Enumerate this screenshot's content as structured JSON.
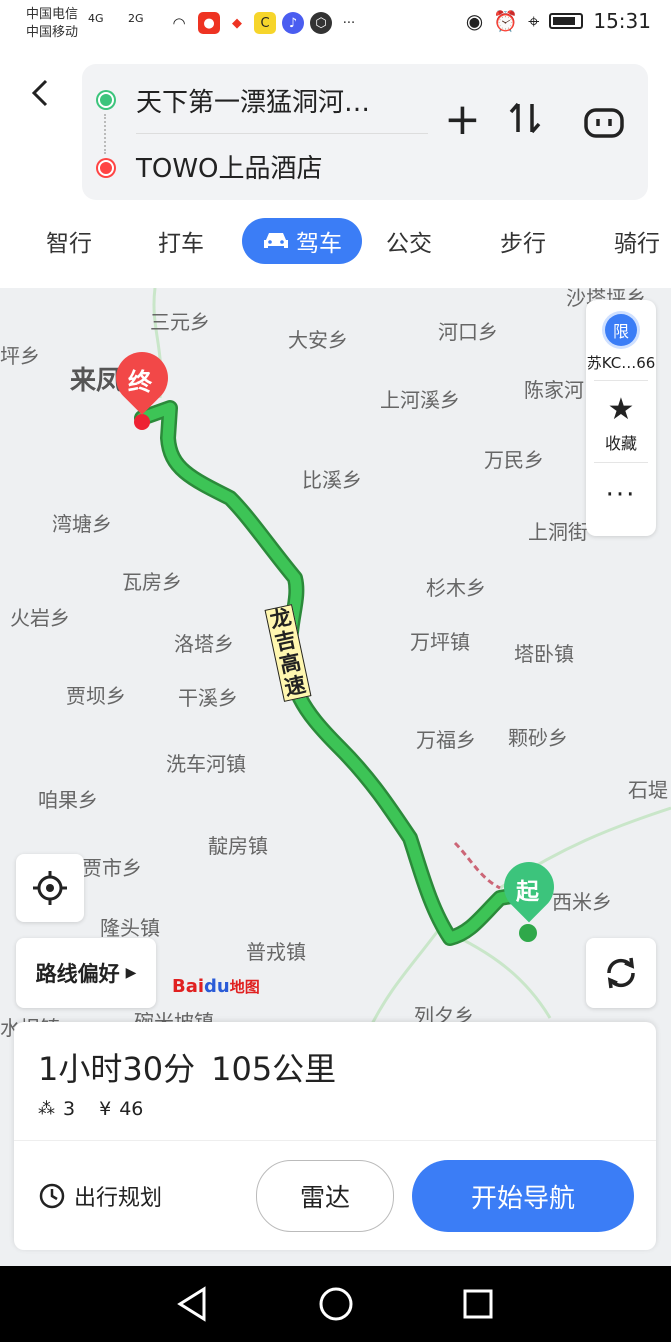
{
  "status_bar": {
    "carrier1": "中国电信",
    "carrier2": "中国移动",
    "net1": "4G",
    "net2": "2G",
    "more": "···",
    "time": "15:31"
  },
  "header": {
    "back_icon": "back-arrow-icon",
    "from": "天下第一漂猛洞河…",
    "to": "TOWO上品酒店",
    "add_label": "+",
    "swap_label": "⇅",
    "tabs": [
      {
        "label": "智行"
      },
      {
        "label": "打车"
      },
      {
        "label": "驾车"
      },
      {
        "label": "公交"
      },
      {
        "label": "步行"
      },
      {
        "label": "骑行"
      }
    ],
    "active_tab": "驾车",
    "accent": "#3b7df6"
  },
  "map": {
    "places": [
      {
        "name": "三元乡"
      },
      {
        "name": "大安乡"
      },
      {
        "name": "河口乡"
      },
      {
        "name": "沙塔坪乡"
      },
      {
        "name": "坪乡"
      },
      {
        "name": "来凤"
      },
      {
        "name": "上河溪乡"
      },
      {
        "name": "陈家河"
      },
      {
        "name": "比溪乡"
      },
      {
        "name": "万民乡"
      },
      {
        "name": "湾塘乡"
      },
      {
        "name": "上洞街"
      },
      {
        "name": "瓦房乡"
      },
      {
        "name": "杉木乡"
      },
      {
        "name": "火岩乡"
      },
      {
        "name": "洛塔乡"
      },
      {
        "name": "万坪镇"
      },
      {
        "name": "塔卧镇"
      },
      {
        "name": "贾坝乡"
      },
      {
        "name": "干溪乡"
      },
      {
        "name": "万福乡"
      },
      {
        "name": "颗砂乡"
      },
      {
        "name": "洗车河镇"
      },
      {
        "name": "石堤"
      },
      {
        "name": "咱果乡"
      },
      {
        "name": "靛房镇"
      },
      {
        "name": "西米乡"
      },
      {
        "name": "贾市乡"
      },
      {
        "name": "隆头镇"
      },
      {
        "name": "普戎镇"
      },
      {
        "name": "列夕乡"
      },
      {
        "name": "水坝镇"
      },
      {
        "name": "碗米坡镇"
      }
    ],
    "road_label": "龙吉高速",
    "end_marker": "终",
    "start_marker": "起",
    "route_color": "#2fb84a",
    "plate_badge": "限",
    "plate_text": "苏KC…66",
    "favorite": "收藏",
    "more": "···",
    "route_pref": "路线偏好",
    "logo_text": "Bai",
    "logo_text2": "du",
    "logo_text3": "地图"
  },
  "route_card": {
    "duration": "1小时30分",
    "distance": "105公里",
    "traffic_lights": "3",
    "toll_symbol": "¥",
    "toll": "46",
    "plan_label": "出行规划",
    "radar_label": "雷达",
    "navigate_label": "开始导航"
  }
}
